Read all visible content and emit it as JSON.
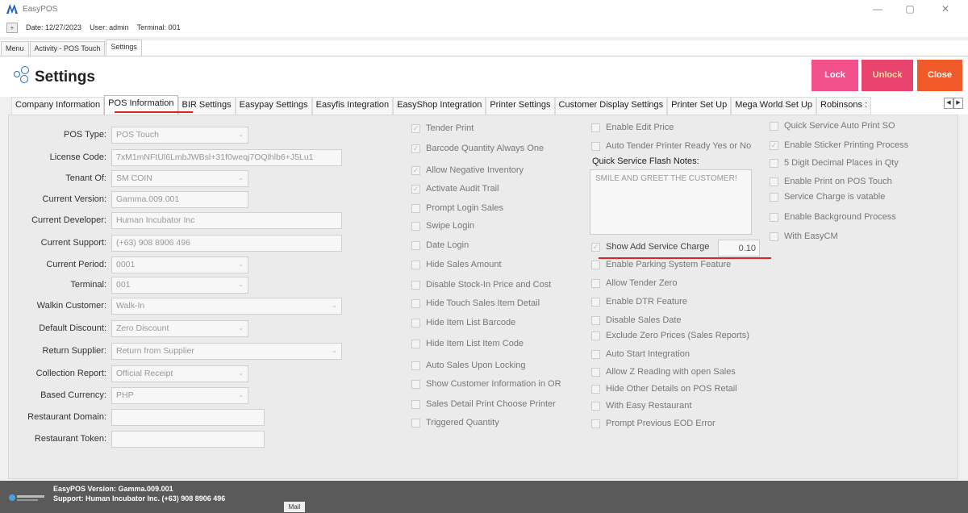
{
  "window": {
    "title": "EasyPOS",
    "minimize": "—",
    "maximize": "▢",
    "close": "✕"
  },
  "infobar": {
    "expand": "+",
    "date": "Date: 12/27/2023",
    "user": "User: admin",
    "terminal": "Terminal: 001"
  },
  "outer_tabs": [
    "Menu",
    "Activity - POS Touch",
    "Settings"
  ],
  "header": {
    "title": "Settings",
    "lock": "Lock",
    "unlock": "Unlock",
    "close": "Close",
    "colors": {
      "lock": "#f2508a",
      "unlock": "#e8446e",
      "close": "#f05a28"
    }
  },
  "inner_tabs": [
    "Company Information",
    "POS Information",
    "BIR Settings",
    "Easypay Settings",
    "Easyfis Integration",
    "EasyShop Integration",
    "Printer Settings",
    "Customer Display Settings",
    "Printer Set Up",
    "Mega World Set Up",
    "Robinsons :"
  ],
  "fields": [
    {
      "label": "POS Type:",
      "value": "POS Touch",
      "dropdown": true
    },
    {
      "label": "License Code:",
      "value": "7xM1mNFtUl6LmbJWBsl+31f0weqj7OQlhlb6+J5Lu1",
      "dropdown": false
    },
    {
      "label": "Tenant Of:",
      "value": "SM COIN",
      "dropdown": true
    },
    {
      "label": "Current Version:",
      "value": "Gamma.009.001",
      "dropdown": false
    },
    {
      "label": "Current Developer:",
      "value": "Human Incubator Inc",
      "dropdown": false
    },
    {
      "label": "Current Support:",
      "value": "(+63) 908 8906 496",
      "dropdown": false
    },
    {
      "label": "Current Period:",
      "value": "0001",
      "dropdown": true
    },
    {
      "label": "Terminal:",
      "value": "001",
      "dropdown": true
    },
    {
      "label": "Walkin Customer:",
      "value": "Walk-In",
      "dropdown": true
    },
    {
      "label": "Default Discount:",
      "value": "Zero Discount",
      "dropdown": true
    },
    {
      "label": "Return Supplier:",
      "value": "Return from Supplier",
      "dropdown": true
    },
    {
      "label": "Collection Report:",
      "value": "Official Receipt",
      "dropdown": true
    },
    {
      "label": "Based Currency:",
      "value": "PHP",
      "dropdown": true
    },
    {
      "label": "Restaurant Domain:",
      "value": "",
      "dropdown": false
    },
    {
      "label": "Restaurant Token:",
      "value": "",
      "dropdown": false
    }
  ],
  "col2": [
    {
      "label": "Tender Print",
      "checked": true
    },
    {
      "label": "Barcode Quantity Always One",
      "checked": true
    },
    {
      "label": "Allow Negative Inventory",
      "checked": true
    },
    {
      "label": "Activate Audit Trail",
      "checked": true
    },
    {
      "label": "Prompt Login Sales",
      "checked": false
    },
    {
      "label": "Swipe Login",
      "checked": false
    },
    {
      "label": "Date Login",
      "checked": false
    },
    {
      "label": "Hide Sales Amount",
      "checked": false
    },
    {
      "label": "Disable Stock-In Price and Cost",
      "checked": false
    },
    {
      "label": "Hide Touch Sales Item Detail",
      "checked": false
    },
    {
      "label": "Hide Item List Barcode",
      "checked": false
    },
    {
      "label": "Hide Item List Item Code",
      "checked": false
    },
    {
      "label": "Auto Sales Upon Locking",
      "checked": false
    },
    {
      "label": "Show Customer Information in OR",
      "checked": false
    },
    {
      "label": "Sales Detail Print Choose Printer",
      "checked": false
    },
    {
      "label": "Triggered Quantity",
      "checked": false
    }
  ],
  "col3_top": [
    {
      "label": "Enable Edit Price",
      "checked": false
    },
    {
      "label": "Auto Tender Printer Ready Yes or No",
      "checked": false
    }
  ],
  "flash_notes": {
    "label": "Quick Service Flash Notes:",
    "value": "SMILE AND GREET THE CUSTOMER!"
  },
  "service_charge": {
    "label": "Show Add Service Charge",
    "checked": true,
    "value": "0.10"
  },
  "col3": [
    {
      "label": "Enable Parking System Feature",
      "checked": false
    },
    {
      "label": "Allow Tender Zero",
      "checked": false
    },
    {
      "label": "Enable DTR Feature",
      "checked": false
    },
    {
      "label": "Disable Sales Date",
      "checked": false
    },
    {
      "label": "Exclude Zero Prices (Sales Reports)",
      "checked": false
    },
    {
      "label": "Auto Start Integration",
      "checked": false
    },
    {
      "label": "Allow Z Reading with open Sales",
      "checked": false
    },
    {
      "label": "Hide Other Details on POS Retail",
      "checked": false
    },
    {
      "label": "With Easy Restaurant",
      "checked": false
    },
    {
      "label": "Prompt Previous EOD Error",
      "checked": false
    }
  ],
  "col4": [
    {
      "label": "Quick Service Auto Print SO",
      "checked": false
    },
    {
      "label": "Enable Sticker Printing Process",
      "checked": true
    },
    {
      "label": "5 Digit Decimal Places in Qty",
      "checked": false
    },
    {
      "label": "Enable Print on POS Touch",
      "checked": false
    },
    {
      "label": "Service Charge is vatable",
      "checked": false
    },
    {
      "label": "Enable Background Process",
      "checked": false
    },
    {
      "label": "With EasyCM",
      "checked": false
    }
  ],
  "statusbar": {
    "version": "EasyPOS Version: Gamma.009.001",
    "support": "Support: Human Incubator Inc. (+63) 908 8906 496",
    "mail": "Mail"
  }
}
